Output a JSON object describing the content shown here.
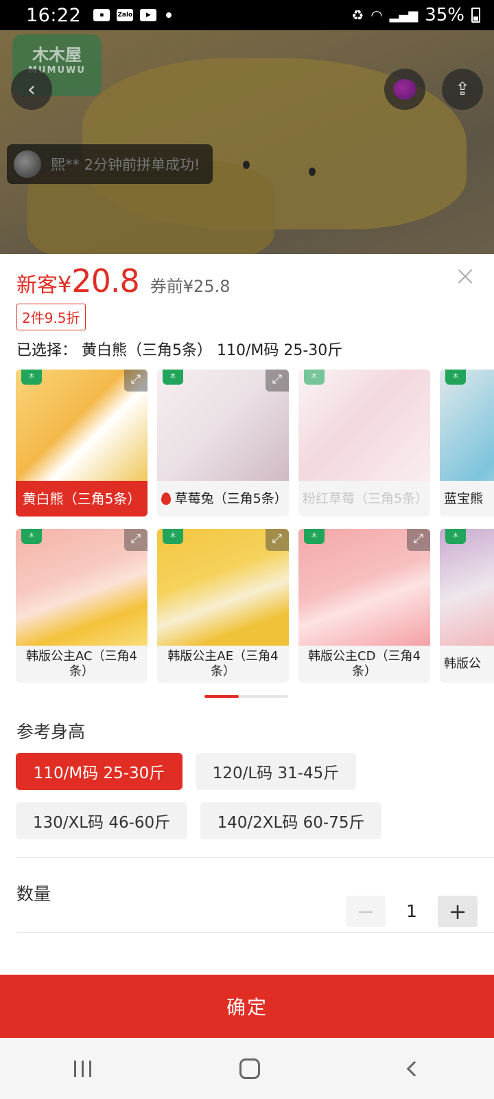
{
  "status_bar": {
    "time": "16:22",
    "battery": "35%",
    "notif_icons": [
      "image-icon",
      "zalo-icon",
      "youtube-icon"
    ]
  },
  "hero": {
    "brand_name": "木木屋",
    "brand_sub": "MUMUWU",
    "toast_text": "熙** 2分钟前拼单成功!"
  },
  "price": {
    "label": "新客",
    "currency": "¥",
    "value": "20.8",
    "original": "券前¥25.8"
  },
  "discount_tag": "2件9.5折",
  "selected_text": "已选择：  黄白熊（三角5条）  110/M码 25-30斤",
  "variants_row1": [
    {
      "label": "黄白熊（三角5条）",
      "state": "selected"
    },
    {
      "label": "草莓兔（三角5条）",
      "state": "hot"
    },
    {
      "label": "粉红草莓（三角5条）",
      "state": "disabled"
    },
    {
      "label": "蓝宝熊",
      "state": "normal"
    }
  ],
  "variants_row2": [
    {
      "label": "韩版公主AC（三角4条）"
    },
    {
      "label": "韩版公主AE（三角4条）"
    },
    {
      "label": "韩版公主CD（三角4条）"
    },
    {
      "label": "韩版公"
    }
  ],
  "height_section": {
    "title": "参考身高",
    "options": [
      "110/M码 25-30斤",
      "120/L码 31-45斤",
      "130/XL码 46-60斤",
      "140/2XL码 60-75斤"
    ],
    "selected": "110/M码 25-30斤"
  },
  "quantity": {
    "label": "数量",
    "value": "1",
    "minus": "−",
    "plus": "+"
  },
  "confirm_label": "确定",
  "colors": {
    "accent": "#e02e24"
  }
}
